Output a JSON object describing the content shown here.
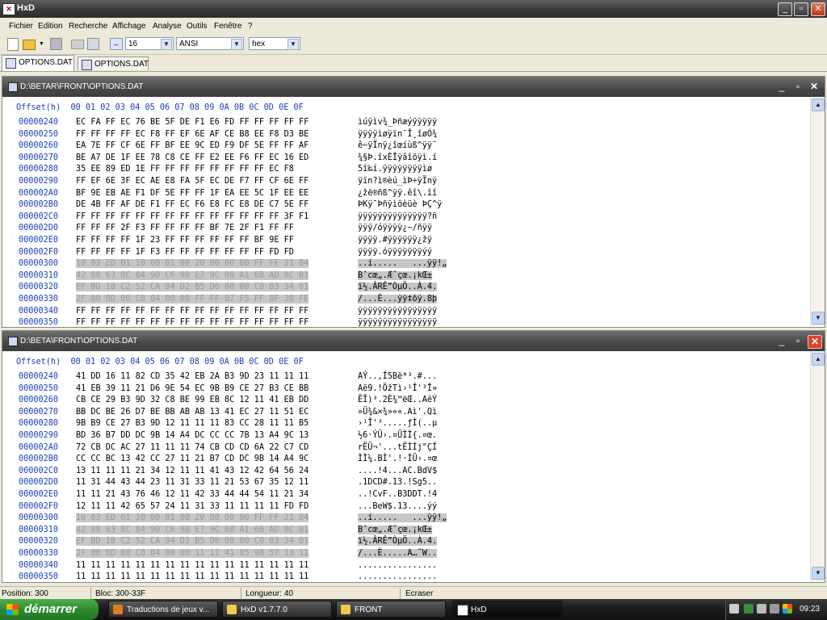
{
  "window": {
    "title": "HxD",
    "min_glyph": "_",
    "max_glyph": "▫",
    "close_glyph": "✕"
  },
  "menu": [
    "Fichier",
    "Edition",
    "Recherche",
    "Affichage",
    "Analyse",
    "Outils",
    "Fenêtre",
    "?"
  ],
  "toolbar": {
    "bytes_per_row": "16",
    "charset": "ANSI",
    "offset_base": "hex"
  },
  "tabs": [
    {
      "label": "OPTIONS.DAT",
      "active": true
    },
    {
      "label": "OPTIONS.DAT",
      "active": false
    }
  ],
  "header_line": "Offset(h)  00 01 02 03 04 05 06 07 08 09 0A 0B 0C 0D 0E 0F",
  "panels": [
    {
      "title": "D:\\BETAR\\FRONT\\OPTIONS.DAT",
      "rows": [
        {
          "offset": "00000240",
          "hex": "EC FA FF EC 76 BE 5F DE F1 E6 FD FF FF FF FF FF",
          "ascii": "ìúÿìv¾_Þñæýÿÿÿÿÿ",
          "selected": false
        },
        {
          "offset": "00000250",
          "hex": "FF FF FF FF EC F8 FF EF 6E AF CE B8 EE F8 D3 BE",
          "ascii": "ÿÿÿÿìøÿïn¯Î¸îøÓ¾",
          "selected": false
        },
        {
          "offset": "00000260",
          "hex": "EA 7E FF CF 6E FF BF EE 9C ED F9 DF 5E FF FF AF",
          "ascii": "ê~ÿÏnÿ¿îœíùß^ÿÿ¯",
          "selected": false
        },
        {
          "offset": "00000270",
          "hex": "BE A7 DE 1F EE 78 C8 CE FF E2 EE F6 FF EC 16 ED",
          "ascii": "¾§Þ.îxÈÎÿâîöÿì.í",
          "selected": false
        },
        {
          "offset": "00000280",
          "hex": "35 EE 89 ED 1E FF FF FF FF FF FF FF FF EC F8",
          "ascii": "5î‰í.ÿÿÿÿÿÿÿÿìø",
          "selected": false
        },
        {
          "offset": "00000290",
          "hex": "FF EF 6E 3F EC AE E8 FA 5F EC DE F7 FF CF 6E FF",
          "ascii": "ÿïn?ì®èú_ìÞ÷ÿÏnÿ",
          "selected": false
        },
        {
          "offset": "000002A0",
          "hex": "BF 9E EB AE F1 DF 5E FF FF 1F EA EE 5C 1F EE EE",
          "ascii": "¿žë®ñß^ÿÿ.êî\\.îî",
          "selected": false
        },
        {
          "offset": "000002B0",
          "hex": "DE 4B FF AF DE F1 FF EC F6 E8 FC E8 DE C7 5E FF",
          "ascii": "ÞKÿ¯Þñÿìöèüè ÞÇ^ÿ",
          "selected": false
        },
        {
          "offset": "000002C0",
          "hex": "FF FF FF FF FF FF FF FF FF FF FF FF FF FF 3F F1",
          "ascii": "ÿÿÿÿÿÿÿÿÿÿÿÿÿÿ?ñ",
          "selected": false
        },
        {
          "offset": "000002D0",
          "hex": "FF FF FF 2F F3 FF FF FF FF BF 7E 2F F1 FF FF",
          "ascii": "ÿÿÿ/óÿÿÿÿ¿~/ñÿÿ",
          "selected": false
        },
        {
          "offset": "000002E0",
          "hex": "FF FF FF FF 1F 23 FF FF FF FF FF FF BF 9E FF",
          "ascii": "ÿÿÿÿ.#ÿÿÿÿÿÿ¿žÿ",
          "selected": false
        },
        {
          "offset": "000002F0",
          "hex": "FF FF FF FF 1F F3 FF FF FF FF FF FF FF FD FD",
          "ascii": "ÿÿÿÿ.óÿÿÿÿÿÿÿýý",
          "selected": false
        },
        {
          "offset": "00000300",
          "hex": "10 03 ED 01 10 00 01 00 20 00 00 00 FF FF 21 84",
          "ascii": "..í.....   ...ÿÿ!„",
          "selected": true
        },
        {
          "offset": "00000310",
          "hex": "42 88 63 8C 84 90 C6 98 E7 9C 08 A1 6B AD 8C B1",
          "ascii": "Bˆcœ„.Æ˜çœ.¡k­Œ±",
          "selected": true
        },
        {
          "offset": "00000320",
          "hex": "EF BD 10 C2 52 CA 94 D2 B5 D6 00 00 C0 03 34 01",
          "ascii": "ï½.ÂRÊ”ÒµÖ..À.4.",
          "selected": true
        },
        {
          "offset": "00000330",
          "hex": "2F 00 0D 00 C8 04 00 00 FF FF 87 F5 FF 8F 38 FE",
          "ascii": "/...È...ÿÿ‡õÿ.8þ",
          "selected": true
        },
        {
          "offset": "00000340",
          "hex": "FF FF FF FF FF FF FF FF FF FF FF FF FF FF FF FF",
          "ascii": "ÿÿÿÿÿÿÿÿÿÿÿÿÿÿÿÿ",
          "selected": false
        },
        {
          "offset": "00000350",
          "hex": "FF FF FF FF FF FF FF FF FF FF FF FF FF FF FF FF",
          "ascii": "ÿÿÿÿÿÿÿÿÿÿÿÿÿÿÿÿ",
          "selected": false
        }
      ]
    },
    {
      "title": "D:\\BETA\\FRONT\\OPTIONS.DAT",
      "rows": [
        {
          "offset": "00000240",
          "hex": "41 DD 16 11 82 CD 35 42 EB 2A B3 9D 23 11 11 11",
          "ascii": "AÝ..‚Í5Bë*³.#...",
          "selected": false
        },
        {
          "offset": "00000250",
          "hex": "41 EB 39 11 21 D6 9E 54 EC 9B B9 CE 27 B3 CE BB",
          "ascii": "Aë9.!ÖžTì›¹Î'³Î»",
          "selected": false
        },
        {
          "offset": "00000260",
          "hex": "CB CE 29 B3 9D 32 C8 BE 99 EB 8C 12 11 41 EB DD",
          "ascii": "ËÎ)³.2È¾™ëŒ..AëÝ",
          "selected": false
        },
        {
          "offset": "00000270",
          "hex": "BB DC BE 26 D7 BE BB AB AB 13 41 EC 27 11 51 EC",
          "ascii": "»Ü¾&×¾»««.Aì'.Qì",
          "selected": false
        },
        {
          "offset": "00000280",
          "hex": "9B B9 CE 27 B3 9D 12 11 11 11 83 CC 28 11 11 B5",
          "ascii": "›¹Î'³.....ƒÌ(..µ",
          "selected": false
        },
        {
          "offset": "00000290",
          "hex": "BD 36 B7 DD DC 9B 14 A4 DC CC CC 7B 13 A4 9C 13",
          "ascii": "½6·ÝÜ›.¤ÜÌÌ{.¤œ.",
          "selected": false
        },
        {
          "offset": "000002A0",
          "hex": "72 CB DC AC 27 11 11 11 74 CB CD CD 6A 22 C7 CD",
          "ascii": "rËÜ¬'...tËÍÍj\"ÇÍ",
          "selected": false
        },
        {
          "offset": "000002B0",
          "hex": "CC CC BC 13 42 CC 27 11 21 B7 CD DC 9B 14 A4 9C",
          "ascii": "ÌÌ¼.BÌ'.!·ÍÜ›.¤œ",
          "selected": false
        },
        {
          "offset": "000002C0",
          "hex": "13 11 11 11 21 34 12 11 11 41 43 12 42 64 56 24",
          "ascii": "....!4...AC.BdV$",
          "selected": false
        },
        {
          "offset": "000002D0",
          "hex": "11 31 44 43 44 23 11 31 33 11 21 53 67 35 12 11",
          "ascii": ".1DCD#.13.!Sg5..",
          "selected": false
        },
        {
          "offset": "000002E0",
          "hex": "11 11 21 43 76 46 12 11 42 33 44 44 54 11 21 34",
          "ascii": "..!CvF..B3DDT.!4",
          "selected": false
        },
        {
          "offset": "000002F0",
          "hex": "12 11 11 42 65 57 24 11 31 33 11 11 11 11 FD FD",
          "ascii": "...BeW$.13....ýý",
          "selected": false
        },
        {
          "offset": "00000300",
          "hex": "10 03 ED 01 10 00 01 00 20 00 00 00 FF FF 21 84",
          "ascii": "..í.....   ...ÿÿ!„",
          "selected": true
        },
        {
          "offset": "00000310",
          "hex": "42 88 63 8C 84 90 C6 98 E7 9C 08 A1 6B AD 8C B1",
          "ascii": "Bˆcœ„.Æ˜çœ.¡k­Œ±",
          "selected": true
        },
        {
          "offset": "00000320",
          "hex": "EF BD 10 C2 52 CA 94 D2 B5 D6 00 00 C0 03 34 01",
          "ascii": "ï½.ÂRÊ”ÒµÖ..À.4.",
          "selected": true
        },
        {
          "offset": "00000330",
          "hex": "2F 00 0D 00 C8 04 00 00 11 11 41 85 98 57 13 11",
          "ascii": "/...È.....A…˜W..",
          "selected": true
        },
        {
          "offset": "00000340",
          "hex": "11 11 11 11 11 11 11 11 11 11 11 11 11 11 11 11",
          "ascii": "................",
          "selected": false
        },
        {
          "offset": "00000350",
          "hex": "11 11 11 11 11 11 11 11 11 11 11 11 11 11 11 11",
          "ascii": "................",
          "selected": false
        }
      ]
    }
  ],
  "status": {
    "position": "Position: 300",
    "block": "Bloc: 300-33F",
    "length": "Longueur: 40",
    "mode": "Ecraser"
  },
  "taskbar": {
    "start_label": "démarrer",
    "tasks": [
      {
        "label": "Traductions de jeux v...",
        "icon_color": "#e07a1f",
        "active": false
      },
      {
        "label": "HxD v1.7.7.0",
        "icon_color": "#f2c94c",
        "active": false
      },
      {
        "label": "FRONT",
        "icon_color": "#f2c94c",
        "active": false
      },
      {
        "label": "HxD",
        "icon_color": "#ffffff",
        "active": true
      }
    ],
    "clock": "09:23"
  }
}
